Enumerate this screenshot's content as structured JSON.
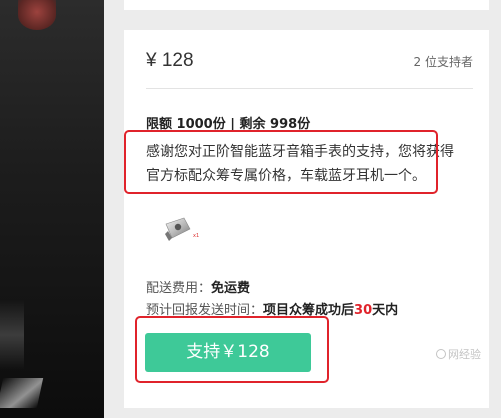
{
  "reward": {
    "price": "¥ 128",
    "supporters": "2 位支持者",
    "quota_limit": "限额 1000份",
    "quota_sep": " | ",
    "quota_remaining": "剩余 998份",
    "description": "感谢您对正阶智能蓝牙音箱手表的支持，您将获得官方标配众筹专属价格，车载蓝牙耳机一个。",
    "shipping_label": "配送费用：",
    "shipping_value": "免运费",
    "delivery_label": "预计回报发送时间：",
    "delivery_prefix": "项目众筹成功后",
    "delivery_days": "30",
    "delivery_suffix": "天内",
    "button_label": "支持￥128"
  },
  "colors": {
    "accent_green": "#3ec998",
    "highlight_red": "#e0232b"
  },
  "watermark_text": "网经验"
}
